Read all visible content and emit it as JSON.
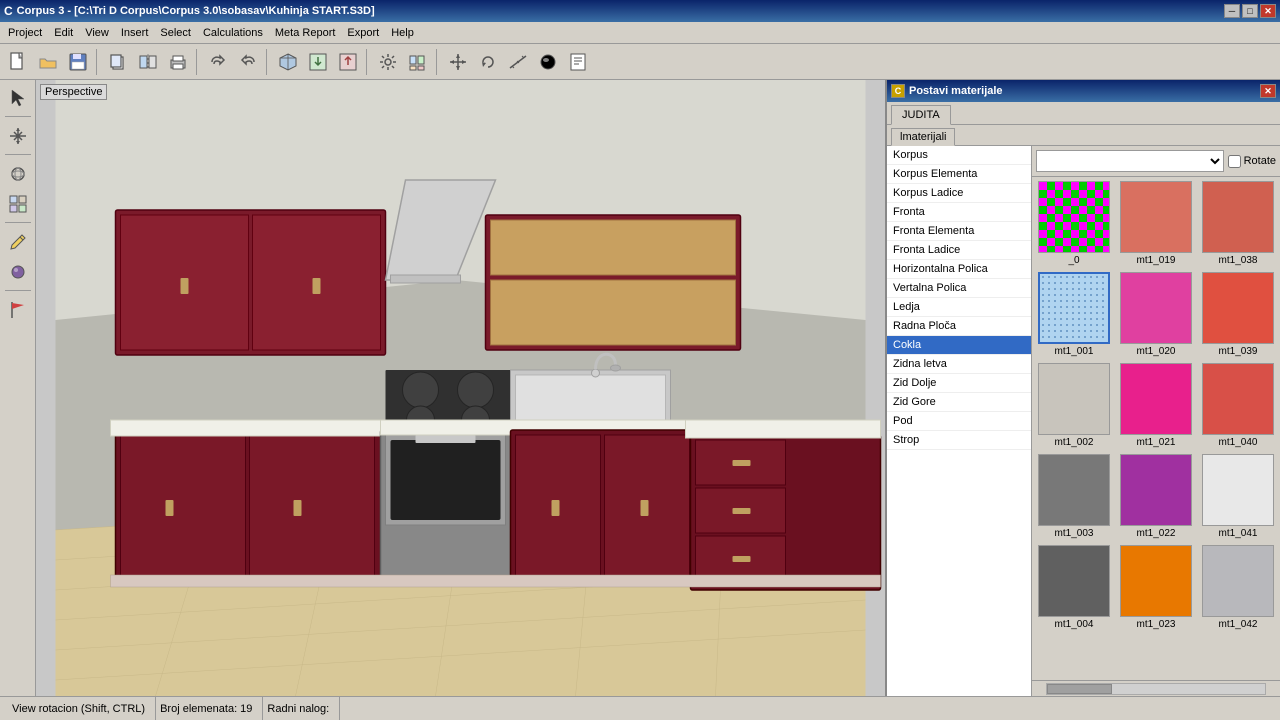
{
  "titlebar": {
    "title": "Corpus 3 - [C:\\Tri D Corpus\\Corpus 3.0\\sobasav\\Kuhinja START.S3D]",
    "icon": "C",
    "min_btn": "─",
    "max_btn": "□",
    "close_btn": "✕"
  },
  "menubar": {
    "items": [
      "Project",
      "Edit",
      "View",
      "Insert",
      "Select",
      "Calculations",
      "Meta Report",
      "Export",
      "Help"
    ]
  },
  "toolbar": {
    "buttons": [
      "📄",
      "📁",
      "💾",
      "📋",
      "✂️",
      "🖨",
      "↩",
      "🔄",
      "📦",
      "📥",
      "📤",
      "🔧",
      "📊",
      "📌",
      "🔍",
      "✏️",
      "🗑"
    ]
  },
  "viewport": {
    "label": "Perspective"
  },
  "dialog": {
    "title": "Postavi materijale",
    "icon": "C",
    "close_btn": "✕",
    "tabs": [
      "JUDITA"
    ],
    "sub_tabs": [
      "lmaterijali"
    ],
    "dropdown_placeholder": "",
    "rotate_label": "Rotate",
    "list_items": [
      {
        "label": "Korpus",
        "type": "normal"
      },
      {
        "label": "Korpus Elementa",
        "type": "normal"
      },
      {
        "label": "Korpus Ladice",
        "type": "normal"
      },
      {
        "label": "Fronta",
        "type": "normal"
      },
      {
        "label": "Fronta Elementa",
        "type": "normal"
      },
      {
        "label": "Fronta Ladice",
        "type": "normal"
      },
      {
        "label": "Horizontalna Polica",
        "type": "normal"
      },
      {
        "label": "Vertalna Polica",
        "type": "normal"
      },
      {
        "label": "Ledja",
        "type": "normal"
      },
      {
        "label": "Radna Ploča",
        "type": "normal"
      },
      {
        "label": "Cokla",
        "type": "selected"
      },
      {
        "label": "Zidna letva",
        "type": "normal"
      },
      {
        "label": "Zid Dolje",
        "type": "normal"
      },
      {
        "label": "Zid Gore",
        "type": "normal"
      },
      {
        "label": "Pod",
        "type": "normal"
      },
      {
        "label": "Strop",
        "type": "normal"
      }
    ],
    "materials": [
      {
        "id": "_0",
        "label": "_0",
        "type": "checker",
        "selected": false
      },
      {
        "id": "mt1_019",
        "label": "mt1_019",
        "color": "#d97060",
        "selected": false
      },
      {
        "id": "mt1_038",
        "label": "mt1_038",
        "color": "#d06050",
        "selected": false
      },
      {
        "id": "mt1_001",
        "label": "mt1_001",
        "type": "dotted-blue",
        "selected": true
      },
      {
        "id": "mt1_020",
        "label": "mt1_020",
        "color": "#e040a0",
        "selected": false
      },
      {
        "id": "mt1_039",
        "label": "mt1_039",
        "color": "#e05040",
        "selected": false
      },
      {
        "id": "mt1_002",
        "label": "mt1_002",
        "color": "#c8c4bc",
        "selected": false
      },
      {
        "id": "mt1_021",
        "label": "mt1_021",
        "color": "#e8208c",
        "selected": false
      },
      {
        "id": "mt1_040",
        "label": "mt1_040",
        "color": "#d85048",
        "selected": false
      },
      {
        "id": "mt1_003",
        "label": "mt1_003",
        "color": "#787878",
        "selected": false
      },
      {
        "id": "mt1_022",
        "label": "mt1_022",
        "color": "#a030a0",
        "selected": false
      },
      {
        "id": "mt1_041",
        "label": "mt1_041",
        "color": "#e8e8e8",
        "selected": false
      },
      {
        "id": "mt1_004",
        "label": "mt1_004",
        "color": "#606060",
        "selected": false
      },
      {
        "id": "mt1_023",
        "label": "mt1_023",
        "color": "#e87800",
        "selected": false
      },
      {
        "id": "mt1_042",
        "label": "mt1_042",
        "color": "#b8b8bc",
        "selected": false
      }
    ]
  },
  "statusbar": {
    "items": [
      "View rotacion (Shift, CTRL)",
      "Broj elemenata: 19",
      "Radni nalog:"
    ]
  }
}
